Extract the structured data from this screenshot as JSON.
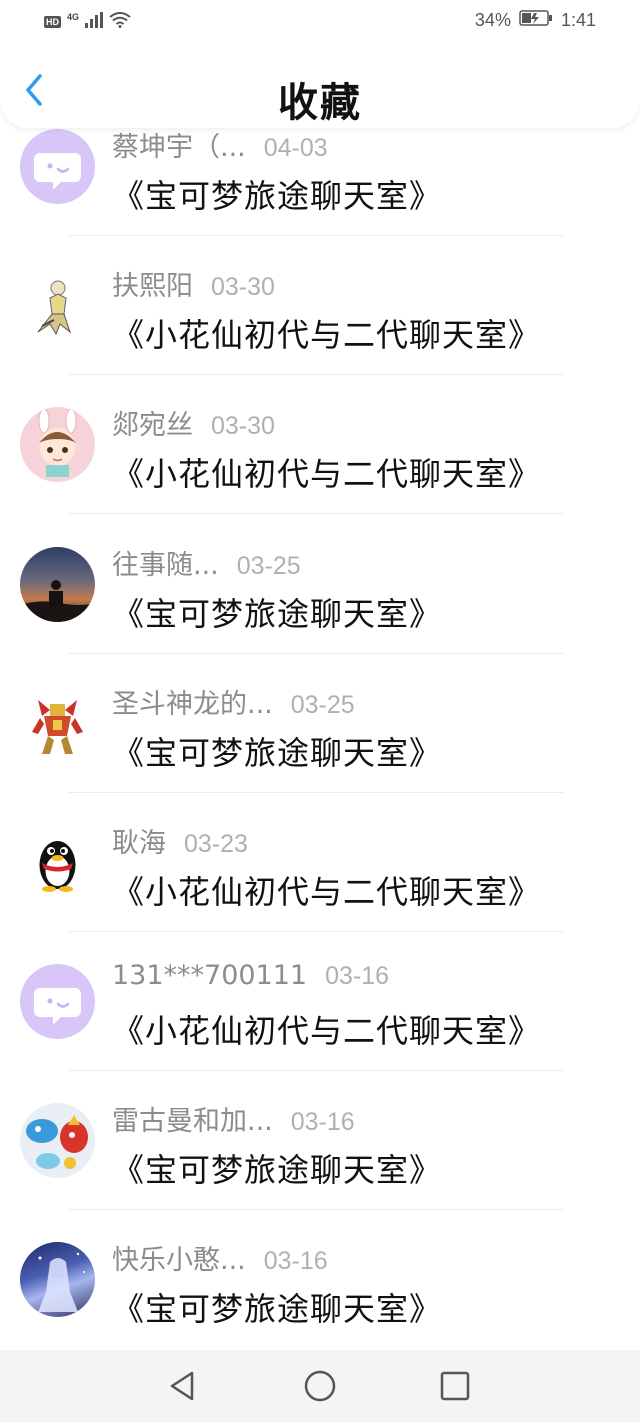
{
  "status_bar": {
    "hd": "HD",
    "network": "4G",
    "battery": "34%",
    "time": "1:41"
  },
  "header": {
    "title": "收藏",
    "back_icon": "chevron-left-icon"
  },
  "colors": {
    "accent": "#2f9bf0",
    "sender": "#8c8c8c",
    "date": "#b0b0b0",
    "divider": "#ececec",
    "chat_avatar_bg": "#d6c4f7"
  },
  "items": [
    {
      "sender": "蔡坤宇（...",
      "date": "04-03",
      "room": "《宝可梦旅途聊天室》",
      "avatar": "chat-bubble-avatar"
    },
    {
      "sender": "扶熙阳",
      "date": "03-30",
      "room": "《小花仙初代与二代聊天室》",
      "avatar": "fairy-character-avatar"
    },
    {
      "sender": "郯宛丝",
      "date": "03-30",
      "room": "《小花仙初代与二代聊天室》",
      "avatar": "bunny-ears-boy-avatar"
    },
    {
      "sender": "往事随...",
      "date": "03-25",
      "room": "《宝可梦旅途聊天室》",
      "avatar": "sunset-silhouette-avatar"
    },
    {
      "sender": "圣斗神龙的...",
      "date": "03-25",
      "room": "《宝可梦旅途聊天室》",
      "avatar": "robot-warrior-avatar"
    },
    {
      "sender": "耿海",
      "date": "03-23",
      "room": "《小花仙初代与二代聊天室》",
      "avatar": "penguin-avatar"
    },
    {
      "sender": "131***700111",
      "date": "03-16",
      "room": "《小花仙初代与二代聊天室》",
      "avatar": "chat-bubble-avatar"
    },
    {
      "sender": "雷古曼和加...",
      "date": "03-16",
      "room": "《宝可梦旅途聊天室》",
      "avatar": "pokemon-collage-avatar"
    },
    {
      "sender": "快乐小憨...",
      "date": "03-16",
      "room": "《宝可梦旅途聊天室》",
      "avatar": "anime-night-avatar"
    }
  ],
  "nav": {
    "back": "triangle-back-icon",
    "home": "circle-home-icon",
    "recents": "square-recents-icon"
  }
}
